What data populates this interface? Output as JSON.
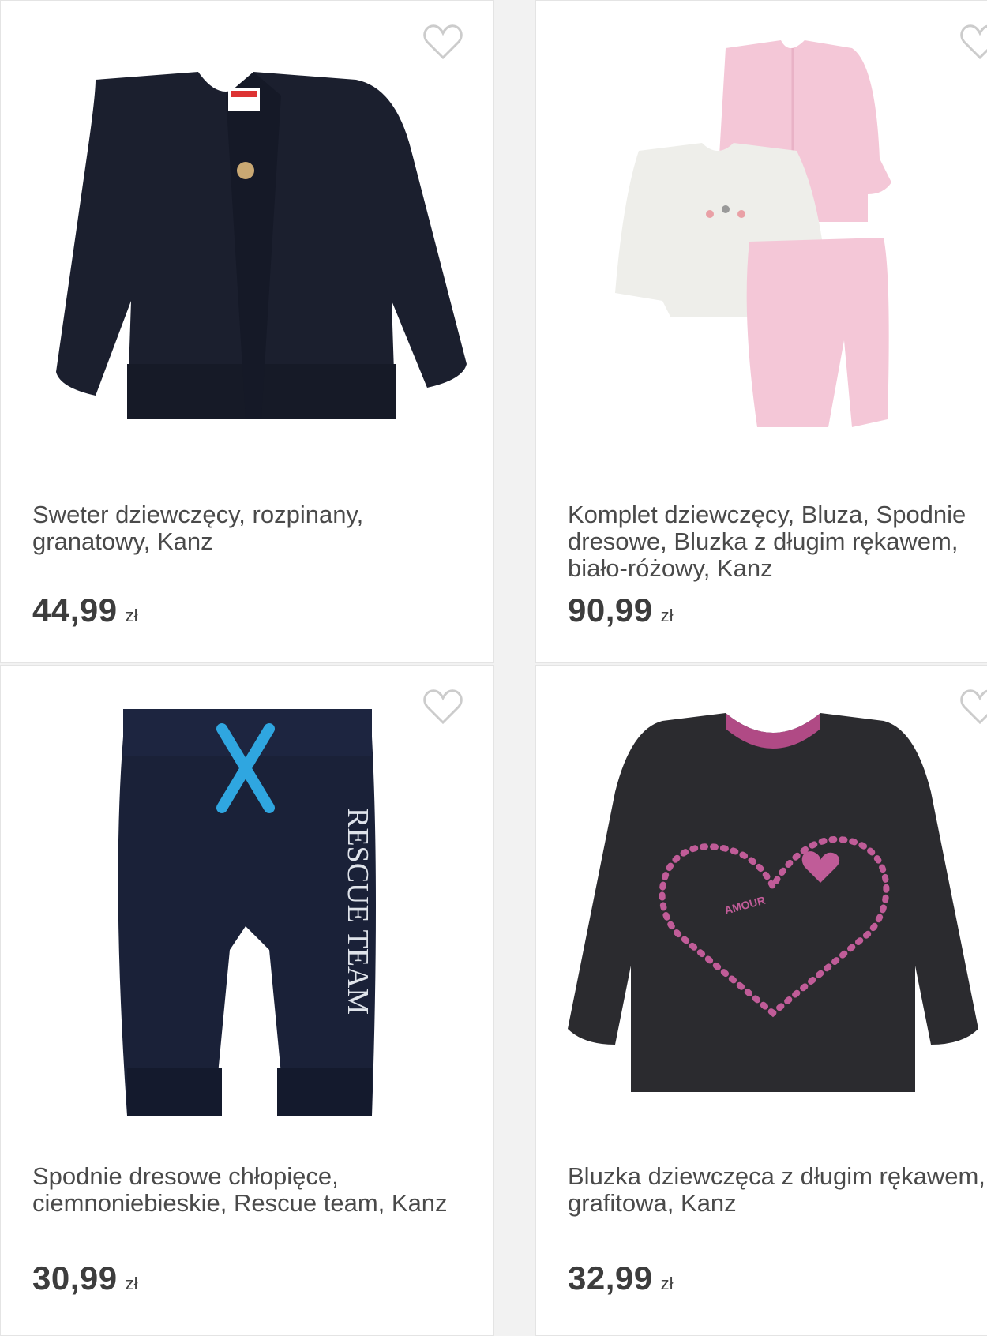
{
  "products": [
    {
      "title": "Sweter dziewczęcy, rozpinany, granatowy, Kanz",
      "price": "44,99",
      "currency": "zł",
      "favorite_icon": "heart-outline-icon"
    },
    {
      "title": "Komplet dziewczęcy, Bluza, Spodnie dresowe, Bluzka z długim rękawem, biało-różowy, Kanz",
      "price": "90,99",
      "currency": "zł",
      "favorite_icon": "heart-outline-icon"
    },
    {
      "title": "Spodnie dresowe chłopięce, ciemnoniebieskie, Rescue team, Kanz",
      "price": "30,99",
      "currency": "zł",
      "favorite_icon": "heart-outline-icon",
      "print_text": "RESCUE TEAM"
    },
    {
      "title": "Bluzka dziewczęca z długim rękawem, grafitowa, Kanz",
      "price": "32,99",
      "currency": "zł",
      "favorite_icon": "heart-outline-icon",
      "print_text": "AMOUR"
    }
  ],
  "colors": {
    "text": "#4a4a4a",
    "price": "#3d3d3d",
    "heart": "#cccccc"
  }
}
